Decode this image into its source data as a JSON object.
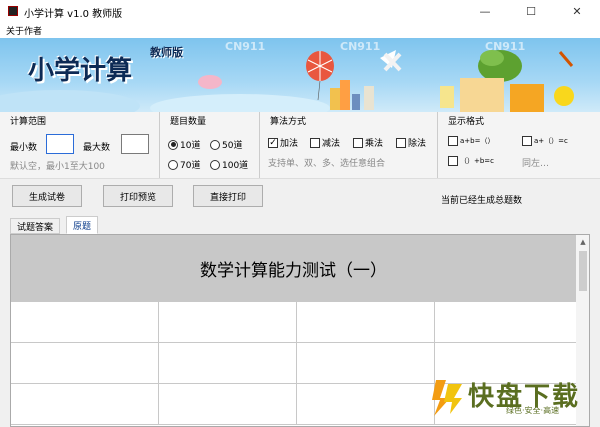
{
  "window": {
    "title": "小学计算 v1.0 教师版",
    "minimize": "—",
    "maximize": "☐",
    "close": "✕"
  },
  "menu": {
    "about": "关于作者"
  },
  "banner": {
    "title": "小学计算",
    "subtitle": "教师版",
    "watermark": "CN911"
  },
  "range": {
    "title": "计算范围",
    "min_label": "最小数",
    "min_value": "",
    "max_label": "最大数",
    "max_value": "",
    "hint": "默认空，最小1至大100"
  },
  "count": {
    "title": "题目数量",
    "options": [
      "10道",
      "50道",
      "70道",
      "100道"
    ],
    "selected": "10道"
  },
  "ops": {
    "title": "算法方式",
    "options": [
      {
        "label": "加法",
        "checked": true
      },
      {
        "label": "减法",
        "checked": false
      },
      {
        "label": "乘法",
        "checked": false
      },
      {
        "label": "除法",
        "checked": false
      }
    ],
    "hint": "支持单、双、多、选任意组合"
  },
  "format": {
    "title": "显示格式",
    "options": [
      "a+b=（）",
      "a+（）=c",
      "（）+b=c"
    ],
    "hint": "同左…"
  },
  "actions": {
    "generate": "生成试卷",
    "preview": "打印预览",
    "print": "直接打印",
    "status": "当前已经生成总题数"
  },
  "tabs": [
    "试题答案",
    "原题"
  ],
  "active_tab": "原题",
  "sheet": {
    "title": "数学计算能力测试（一）"
  },
  "logo": {
    "main": "快盘下载",
    "sub": "绿色·安全·高速"
  }
}
